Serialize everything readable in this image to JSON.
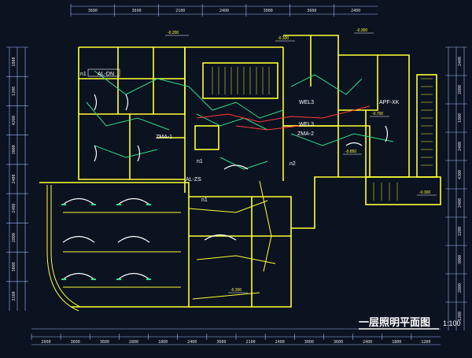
{
  "drawing": {
    "title": "一层照明平面图",
    "scale": "1:100"
  },
  "colors": {
    "background": "#0b1220",
    "wall": "#ffff33",
    "dimension": "#9db7ff",
    "circuit_green": "#2ee08a",
    "circuit_red": "#ff3b3b",
    "fixture": "#ffffff"
  },
  "panels": [
    {
      "id": "p-al-dn",
      "label": "AL-DN"
    },
    {
      "id": "p-zma-1",
      "label": "ZMA-1"
    },
    {
      "id": "p-al-zs",
      "label": "AL-ZS"
    },
    {
      "id": "p-wel3a",
      "label": "WEL3"
    },
    {
      "id": "p-wel3b",
      "label": "WEL3"
    },
    {
      "id": "p-zma-2",
      "label": "ZMA-2"
    },
    {
      "id": "p-apf-xk",
      "label": "APF-XK"
    }
  ],
  "circuits": [
    {
      "id": "c-n1a",
      "label": "n1"
    },
    {
      "id": "c-n1b",
      "label": "n1"
    },
    {
      "id": "c-n2",
      "label": "n2"
    },
    {
      "id": "c-n1c",
      "label": "n1"
    }
  ],
  "levels": [
    {
      "id": "lv-1",
      "label": "-0.200"
    },
    {
      "id": "lv-2",
      "label": "-0.300"
    },
    {
      "id": "lv-3",
      "label": "-0.300"
    },
    {
      "id": "lv-4",
      "label": "-0.700"
    },
    {
      "id": "lv-5",
      "label": "-0.850"
    },
    {
      "id": "lv-6",
      "label": "-0.300"
    },
    {
      "id": "lv-7",
      "label": "-0.300"
    }
  ],
  "bottom_dims": [
    "2000",
    "3600",
    "3600",
    "2800",
    "1800",
    "2400",
    "3600",
    "2100",
    "2400",
    "3000",
    "3600",
    "2400",
    "1800",
    "1200"
  ],
  "left_dims": [
    "1800",
    "1200",
    "4200",
    "3000",
    "2400",
    "2400",
    "2800",
    "3000",
    "2100"
  ],
  "right_dims": [
    "2400",
    "2800",
    "1800",
    "2400",
    "4300",
    "2400",
    "2200",
    "3000",
    "2800",
    "1200"
  ],
  "top_dims": [
    "3600",
    "3600",
    "2100",
    "2400",
    "3000",
    "3600",
    "2400"
  ]
}
